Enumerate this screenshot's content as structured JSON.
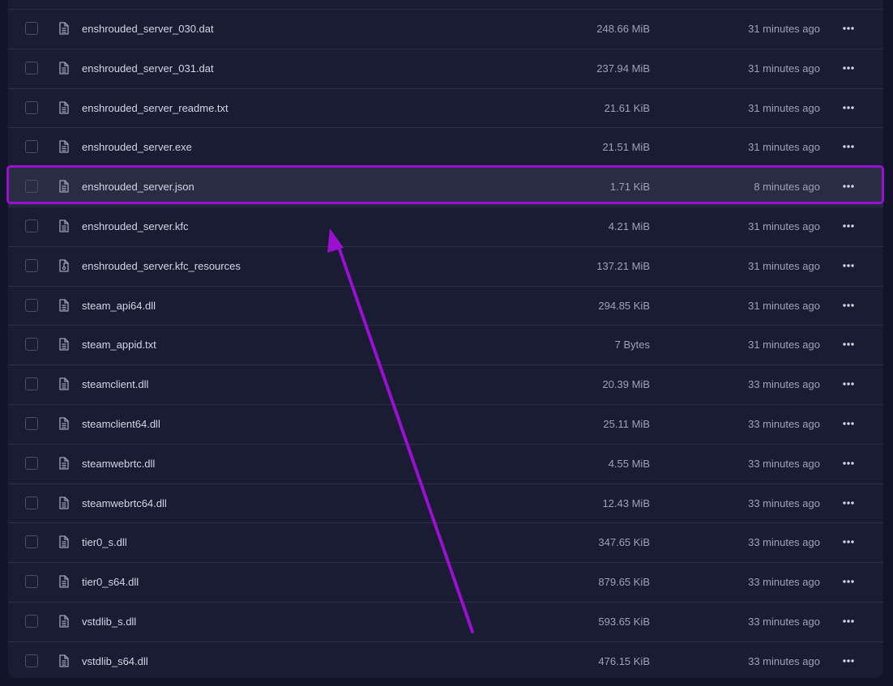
{
  "files": [
    {
      "name": "enshrouded_server_030.dat",
      "size": "248.66 MiB",
      "modified": "31 minutes ago",
      "icon": "document-icon"
    },
    {
      "name": "enshrouded_server_031.dat",
      "size": "237.94 MiB",
      "modified": "31 minutes ago",
      "icon": "document-icon"
    },
    {
      "name": "enshrouded_server_readme.txt",
      "size": "21.61 KiB",
      "modified": "31 minutes ago",
      "icon": "document-icon"
    },
    {
      "name": "enshrouded_server.exe",
      "size": "21.51 MiB",
      "modified": "31 minutes ago",
      "icon": "document-icon"
    },
    {
      "name": "enshrouded_server.json",
      "size": "1.71 KiB",
      "modified": "8 minutes ago",
      "icon": "document-icon",
      "highlighted": true
    },
    {
      "name": "enshrouded_server.kfc",
      "size": "4.21 MiB",
      "modified": "31 minutes ago",
      "icon": "document-icon"
    },
    {
      "name": "enshrouded_server.kfc_resources",
      "size": "137.21 MiB",
      "modified": "31 minutes ago",
      "icon": "archive-file-icon"
    },
    {
      "name": "steam_api64.dll",
      "size": "294.85 KiB",
      "modified": "31 minutes ago",
      "icon": "document-icon"
    },
    {
      "name": "steam_appid.txt",
      "size": "7 Bytes",
      "modified": "31 minutes ago",
      "icon": "document-icon"
    },
    {
      "name": "steamclient.dll",
      "size": "20.39 MiB",
      "modified": "33 minutes ago",
      "icon": "document-icon"
    },
    {
      "name": "steamclient64.dll",
      "size": "25.11 MiB",
      "modified": "33 minutes ago",
      "icon": "document-icon"
    },
    {
      "name": "steamwebrtc.dll",
      "size": "4.55 MiB",
      "modified": "33 minutes ago",
      "icon": "document-icon"
    },
    {
      "name": "steamwebrtc64.dll",
      "size": "12.43 MiB",
      "modified": "33 minutes ago",
      "icon": "document-icon"
    },
    {
      "name": "tier0_s.dll",
      "size": "347.65 KiB",
      "modified": "33 minutes ago",
      "icon": "document-icon"
    },
    {
      "name": "tier0_s64.dll",
      "size": "879.65 KiB",
      "modified": "33 minutes ago",
      "icon": "document-icon"
    },
    {
      "name": "vstdlib_s.dll",
      "size": "593.65 KiB",
      "modified": "33 minutes ago",
      "icon": "document-icon"
    },
    {
      "name": "vstdlib_s64.dll",
      "size": "476.15 KiB",
      "modified": "33 minutes ago",
      "icon": "document-icon"
    }
  ],
  "colors": {
    "annotation": "#9810d0",
    "panel": "#1a1c34",
    "page": "#121429",
    "row_highlight": "#2a2c43"
  },
  "row_actions_icon": "more-horizontal-icon"
}
